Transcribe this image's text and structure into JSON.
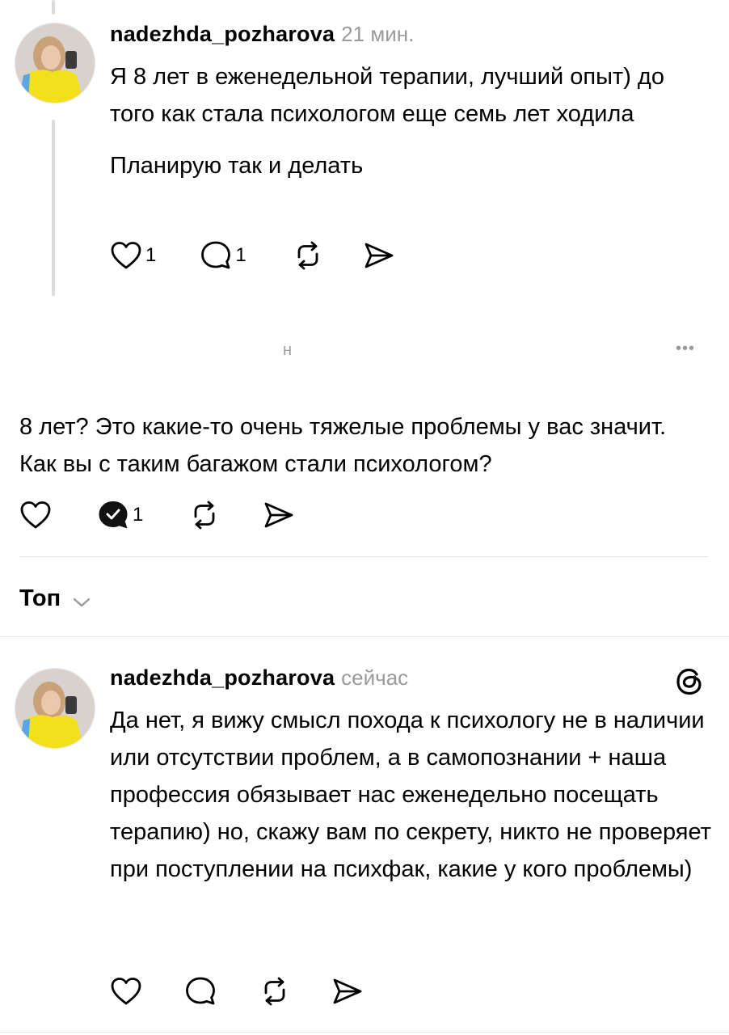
{
  "post1": {
    "username": "nadezhda_pozharova",
    "time": "21 мин.",
    "paragraph1": "Я 8 лет в еженедельной терапии, лучший опыт) до того как стала психологом еще семь лет ходила",
    "paragraph2": "Планирую так и делать",
    "likes": "1",
    "replies": "1"
  },
  "post2": {
    "username_fragment": "н",
    "more_label": "•••",
    "text": "8 лет? Это какие-то очень тяжелые проблемы у вас значит. Как вы с таким багажом стали психологом?",
    "replies": "1"
  },
  "sort": {
    "label": "Топ"
  },
  "post3": {
    "username": "nadezhda_pozharova",
    "time": "сейчас",
    "text": "Да нет, я вижу смысл похода к психологу не в наличии или отсутствии проблем, а в самопознании + наша профессия обязывает нас еженедельно посещать терапию) но, скажу вам по секрету, никто не проверяет при поступлении на психфак, какие у кого проблемы)"
  },
  "icons": {
    "like": "heart-icon",
    "reply": "comment-icon",
    "repost": "repost-icon",
    "share": "send-icon",
    "threads": "threads-logo-icon"
  }
}
